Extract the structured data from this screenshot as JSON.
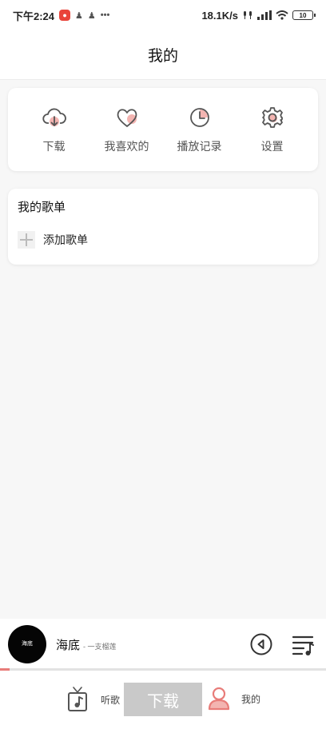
{
  "status_bar": {
    "time": "下午2:24",
    "network_speed": "18.1K/s",
    "battery": "10"
  },
  "header": {
    "title": "我的"
  },
  "quick_actions": [
    {
      "label": "下载",
      "icon": "cloud-download-icon"
    },
    {
      "label": "我喜欢的",
      "icon": "heart-icon"
    },
    {
      "label": "播放记录",
      "icon": "clock-icon"
    },
    {
      "label": "设置",
      "icon": "gear-icon"
    }
  ],
  "playlists": {
    "title": "我的歌单",
    "add_label": "添加歌单"
  },
  "player": {
    "cover_text": "海底",
    "title": "海底",
    "artist": "- 一支榴莲",
    "progress": 0.03
  },
  "tabs": {
    "listen_label": "听歌",
    "download_label": "下载",
    "mine_label": "我的"
  },
  "colors": {
    "accent": "#e87c79",
    "icon_stroke": "#555555",
    "disabled_button": "#c9c9c9"
  }
}
